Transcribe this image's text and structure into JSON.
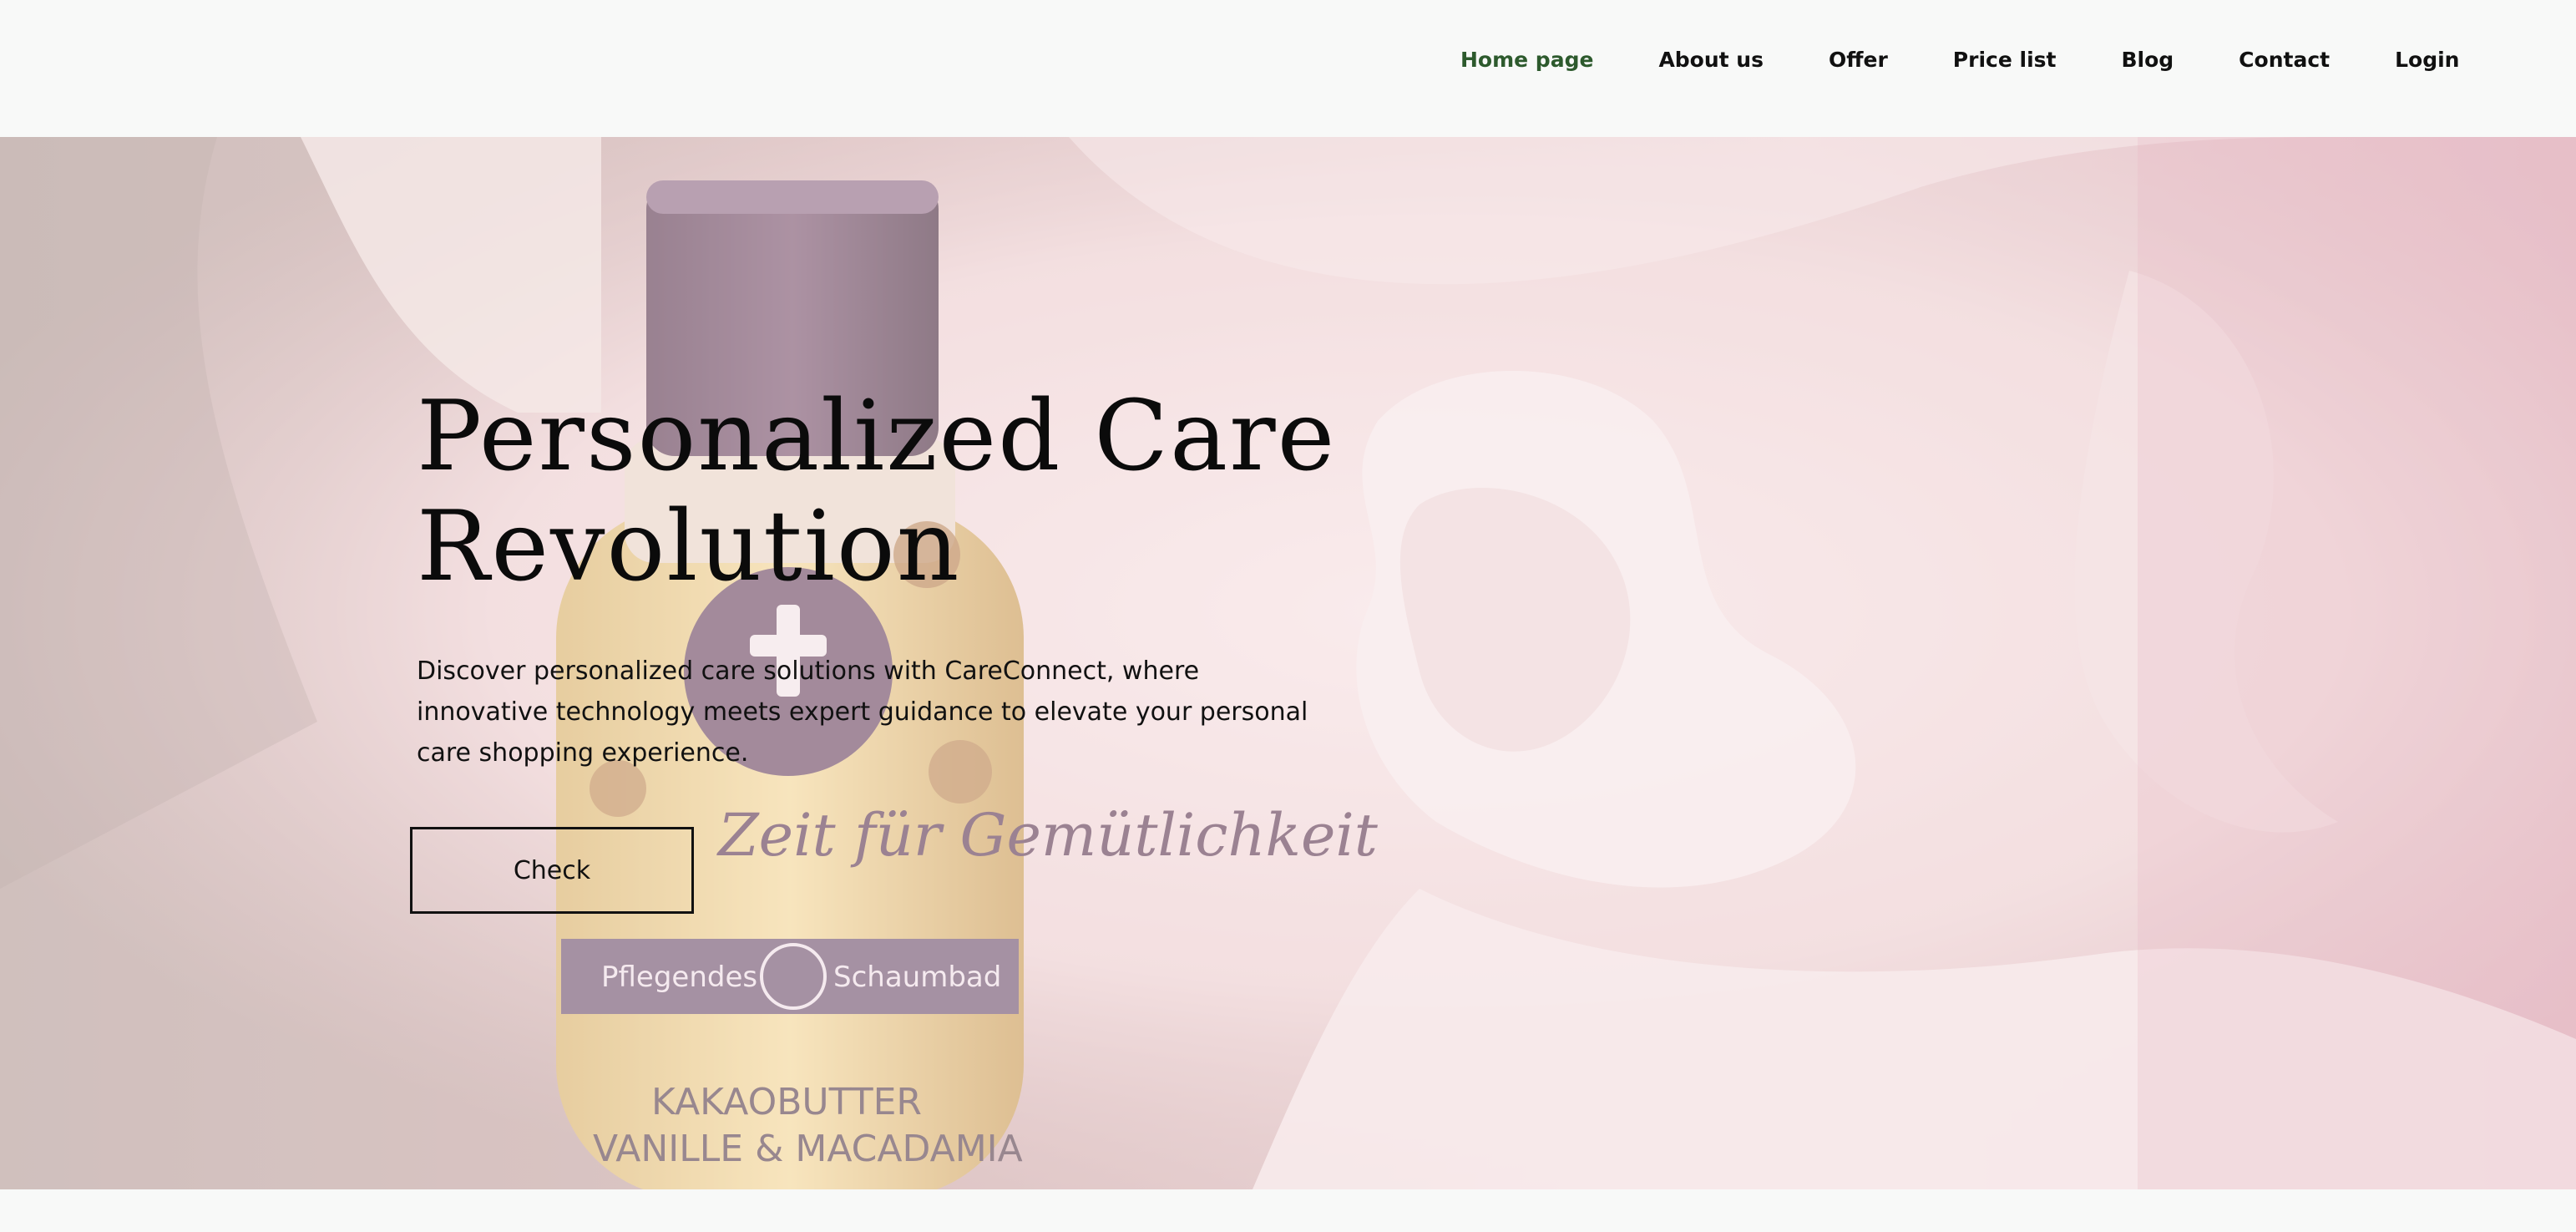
{
  "nav": {
    "items": [
      {
        "label": "Home page",
        "active": true
      },
      {
        "label": "About us",
        "active": false
      },
      {
        "label": "Offer",
        "active": false
      },
      {
        "label": "Price list",
        "active": false
      },
      {
        "label": "Blog",
        "active": false
      },
      {
        "label": "Contact",
        "active": false
      },
      {
        "label": "Login",
        "active": false
      }
    ],
    "active_color": "#2d5a2d"
  },
  "hero": {
    "title_line1": "Personalized Care",
    "title_line2": "Revolution",
    "description": "Discover personalized care solutions with CareConnect, where innovative technology meets expert guidance to elevate your personal care shopping experience.",
    "button_label": "Check",
    "background": {
      "bottle_label_script": "Zeit für Gemütlichkeit",
      "bottle_band_text_left": "Pflegendes",
      "bottle_band_text_right": "Schaumbad",
      "bottle_bottom_line1": "KAKAOBUTTER",
      "bottle_bottom_line2": "VANILLE & MACADAMIA"
    }
  },
  "colors": {
    "page_background": "#f8f9f8",
    "text": "#111111",
    "hero_tint": "#d8b8bc"
  }
}
